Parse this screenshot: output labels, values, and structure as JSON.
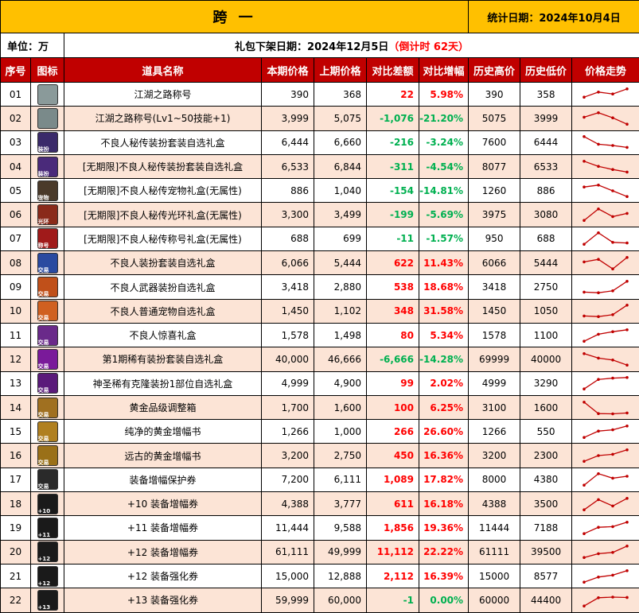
{
  "header": {
    "title": "跨 一",
    "stat_date": "统计日期：2024年10月4日"
  },
  "subheader": {
    "unit": "单位：万",
    "offline_prefix": "礼包下架日期：2024年12月5日",
    "countdown": "（倒计时 62天）"
  },
  "columns": [
    "序号",
    "图标",
    "道具名称",
    "本期价格",
    "上期价格",
    "对比差额",
    "对比增幅",
    "历史高价",
    "历史低价",
    "价格走势"
  ],
  "colors": {
    "header_bg": "#ffc000",
    "column_header_bg": "#c00000",
    "even_row_bg": "#fce4d6",
    "up": "#ff0000",
    "down": "#00b050",
    "trend_line": "#c00000"
  },
  "rows": [
    {
      "idx": "01",
      "name": "江湖之路称号",
      "cur": "390",
      "prev": "368",
      "diff": "22",
      "pct": "5.98%",
      "dir": "up",
      "high": "390",
      "low": "358",
      "icon": "silver-emblem-icon",
      "icon_color": "#8a9a9a",
      "tag": "",
      "trend": [
        0.3,
        0.7,
        0.55,
        0.95
      ]
    },
    {
      "idx": "02",
      "name": "江湖之路称号(Lv1~50技能+1)",
      "cur": "3,999",
      "prev": "5,075",
      "diff": "-1,076",
      "pct": "-21.20%",
      "dir": "down",
      "high": "5075",
      "low": "3999",
      "icon": "silver-emblem-icon",
      "icon_color": "#7a8a8a",
      "tag": "",
      "trend": [
        0.6,
        0.95,
        0.55,
        0.05
      ]
    },
    {
      "idx": "03",
      "name": "不良人秘传装扮套装自选礼盒",
      "cur": "6,444",
      "prev": "6,660",
      "diff": "-216",
      "pct": "-3.24%",
      "dir": "down",
      "high": "7600",
      "low": "6444",
      "icon": "purple-box-icon",
      "icon_color": "#3a2a6a",
      "tag": "装扮",
      "trend": [
        0.95,
        0.35,
        0.25,
        0.1
      ]
    },
    {
      "idx": "04",
      "name": "[无期限]不良人秘传装扮套装自选礼盒",
      "cur": "6,533",
      "prev": "6,844",
      "diff": "-311",
      "pct": "-4.54%",
      "dir": "down",
      "high": "8077",
      "low": "6533",
      "icon": "purple-box-icon",
      "icon_color": "#4a2a7a",
      "tag": "装扮",
      "trend": [
        0.95,
        0.55,
        0.3,
        0.1
      ]
    },
    {
      "idx": "05",
      "name": "[无期限]不良人秘传宠物礼盒(无属性)",
      "cur": "886",
      "prev": "1,040",
      "diff": "-154",
      "pct": "-14.81%",
      "dir": "down",
      "high": "1260",
      "low": "886",
      "icon": "pet-box-icon",
      "icon_color": "#4a3a2a",
      "tag": "宠物",
      "trend": [
        0.8,
        0.95,
        0.5,
        0.05
      ]
    },
    {
      "idx": "06",
      "name": "[无期限]不良人秘传光环礼盒(无属性)",
      "cur": "3,300",
      "prev": "3,499",
      "diff": "-199",
      "pct": "-5.69%",
      "dir": "down",
      "high": "3975",
      "low": "3080",
      "icon": "aura-box-icon",
      "icon_color": "#8a2a1a",
      "tag": "光环",
      "trend": [
        0.05,
        0.95,
        0.35,
        0.6
      ]
    },
    {
      "idx": "07",
      "name": "[无期限]不良人秘传称号礼盒(无属性)",
      "cur": "688",
      "prev": "699",
      "diff": "-11",
      "pct": "-1.57%",
      "dir": "down",
      "high": "950",
      "low": "688",
      "icon": "title-box-icon",
      "icon_color": "#a01a1a",
      "tag": "称号",
      "trend": [
        0.05,
        0.95,
        0.2,
        0.15
      ]
    },
    {
      "idx": "08",
      "name": "不良人装扮套装自选礼盒",
      "cur": "6,066",
      "prev": "5,444",
      "diff": "622",
      "pct": "11.43%",
      "dir": "up",
      "high": "6066",
      "low": "5444",
      "icon": "blue-orb-icon",
      "icon_color": "#2a4aa0",
      "tag": "交易",
      "trend": [
        0.6,
        0.8,
        0.05,
        0.95
      ]
    },
    {
      "idx": "09",
      "name": "不良人武器装扮自选礼盒",
      "cur": "3,418",
      "prev": "2,880",
      "diff": "538",
      "pct": "18.68%",
      "dir": "up",
      "high": "3418",
      "low": "2750",
      "icon": "orange-orb-icon",
      "icon_color": "#c0501a",
      "tag": "交易",
      "trend": [
        0.1,
        0.05,
        0.2,
        0.95
      ]
    },
    {
      "idx": "10",
      "name": "不良人普通宠物自选礼盒",
      "cur": "1,450",
      "prev": "1,102",
      "diff": "348",
      "pct": "31.58%",
      "dir": "up",
      "high": "1450",
      "low": "1050",
      "icon": "orange-orb-icon",
      "icon_color": "#d06020",
      "tag": "交易",
      "trend": [
        0.1,
        0.05,
        0.2,
        0.95
      ]
    },
    {
      "idx": "11",
      "name": "不良人惊喜礼盒",
      "cur": "1,578",
      "prev": "1,498",
      "diff": "80",
      "pct": "5.34%",
      "dir": "up",
      "high": "1578",
      "low": "1100",
      "icon": "purple-orb-icon",
      "icon_color": "#6a2a8a",
      "tag": "交易",
      "trend": [
        0.05,
        0.6,
        0.8,
        0.95
      ]
    },
    {
      "idx": "12",
      "name": "第1期稀有装扮套装自选礼盒",
      "cur": "40,000",
      "prev": "46,666",
      "diff": "-6,666",
      "pct": "-14.28%",
      "dir": "down",
      "high": "69999",
      "low": "40000",
      "icon": "purple-gem-icon",
      "icon_color": "#7a1a9a",
      "tag": "交易",
      "trend": [
        0.95,
        0.6,
        0.45,
        0.05
      ]
    },
    {
      "idx": "13",
      "name": "神圣稀有克隆装扮1部位自选礼盒",
      "cur": "4,999",
      "prev": "4,900",
      "diff": "99",
      "pct": "2.02%",
      "dir": "up",
      "high": "4999",
      "low": "3290",
      "icon": "purple-gem-icon",
      "icon_color": "#5a1a7a",
      "tag": "交易",
      "trend": [
        0.05,
        0.8,
        0.9,
        0.95
      ]
    },
    {
      "idx": "14",
      "name": "黄金品级调整箱",
      "cur": "1,700",
      "prev": "1,600",
      "diff": "100",
      "pct": "6.25%",
      "dir": "up",
      "high": "3100",
      "low": "1600",
      "icon": "gold-box-icon",
      "icon_color": "#a07020",
      "tag": "交易",
      "trend": [
        0.95,
        0.05,
        0.03,
        0.1
      ]
    },
    {
      "idx": "15",
      "name": "纯净的黄金增幅书",
      "cur": "1,266",
      "prev": "1,000",
      "diff": "266",
      "pct": "26.60%",
      "dir": "up",
      "high": "1266",
      "low": "550",
      "icon": "gold-book-icon",
      "icon_color": "#b08020",
      "tag": "交易",
      "trend": [
        0.05,
        0.55,
        0.65,
        0.95
      ]
    },
    {
      "idx": "16",
      "name": "远古的黄金增幅书",
      "cur": "3,200",
      "prev": "2,750",
      "diff": "450",
      "pct": "16.36%",
      "dir": "up",
      "high": "3200",
      "low": "2300",
      "icon": "gold-book-icon",
      "icon_color": "#9a7018",
      "tag": "交易",
      "trend": [
        0.05,
        0.5,
        0.6,
        0.95
      ]
    },
    {
      "idx": "17",
      "name": "装备增幅保护券",
      "cur": "7,200",
      "prev": "6,111",
      "diff": "1,089",
      "pct": "17.82%",
      "dir": "up",
      "high": "8000",
      "low": "4380",
      "icon": "scroll-icon",
      "icon_color": "#2a2a2a",
      "tag": "交易",
      "trend": [
        0.05,
        0.95,
        0.6,
        0.75
      ]
    },
    {
      "idx": "18",
      "name": "+10 装备增幅券",
      "cur": "4,388",
      "prev": "3,777",
      "diff": "611",
      "pct": "16.18%",
      "dir": "up",
      "high": "4388",
      "low": "3500",
      "icon": "amplify-ticket-icon",
      "icon_color": "#1a1a1a",
      "tag": "+10",
      "trend": [
        0.05,
        0.85,
        0.35,
        0.95
      ]
    },
    {
      "idx": "19",
      "name": "+11 装备增幅券",
      "cur": "11,444",
      "prev": "9,588",
      "diff": "1,856",
      "pct": "19.36%",
      "dir": "up",
      "high": "11444",
      "low": "7188",
      "icon": "amplify-ticket-icon",
      "icon_color": "#1a1a1a",
      "tag": "+11",
      "trend": [
        0.05,
        0.55,
        0.6,
        0.95
      ]
    },
    {
      "idx": "20",
      "name": "+12 装备增幅券",
      "cur": "61,111",
      "prev": "49,999",
      "diff": "11,112",
      "pct": "22.22%",
      "dir": "up",
      "high": "61111",
      "low": "39500",
      "icon": "amplify-ticket-icon",
      "icon_color": "#1a1a1a",
      "tag": "+12",
      "trend": [
        0.05,
        0.35,
        0.45,
        0.95
      ]
    },
    {
      "idx": "21",
      "name": "+12 装备强化券",
      "cur": "15,000",
      "prev": "12,888",
      "diff": "2,112",
      "pct": "16.39%",
      "dir": "up",
      "high": "15000",
      "low": "8577",
      "icon": "reinforce-ticket-icon",
      "icon_color": "#1a1a1a",
      "tag": "+12",
      "trend": [
        0.05,
        0.45,
        0.6,
        0.95
      ]
    },
    {
      "idx": "22",
      "name": "+13 装备强化券",
      "cur": "59,999",
      "prev": "60,000",
      "diff": "-1",
      "pct": "0.00%",
      "dir": "flat",
      "high": "60000",
      "low": "44400",
      "icon": "reinforce-ticket-icon",
      "icon_color": "#1a1a1a",
      "tag": "+13",
      "trend": [
        0.05,
        0.7,
        0.75,
        0.72
      ]
    }
  ]
}
